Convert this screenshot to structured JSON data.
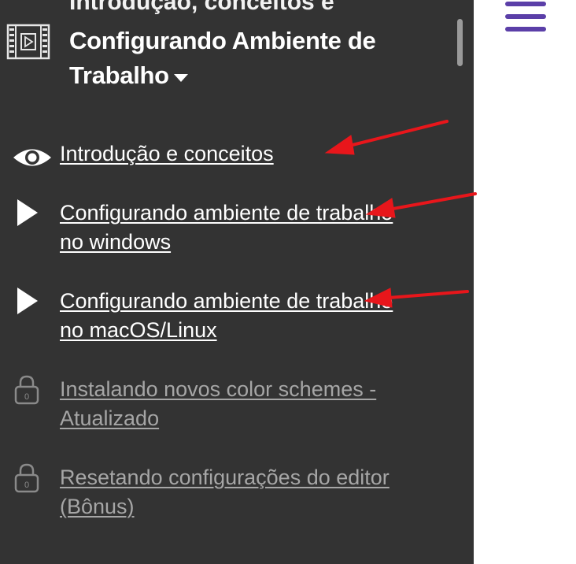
{
  "section": {
    "title": "Configurando Ambiente de Trabalho",
    "cut_heading": "Introdução, conceitos e"
  },
  "lessons": [
    {
      "title": "Introdução e conceitos",
      "icon": "eye-icon",
      "locked": false
    },
    {
      "title": "Configurando ambiente de trabalho no windows",
      "icon": "play-icon",
      "locked": false
    },
    {
      "title": "Configurando ambiente de trabalho no macOS/Linux",
      "icon": "play-icon",
      "locked": false
    },
    {
      "title": "Instalando novos color schemes - Atualizado",
      "icon": "lock-icon",
      "locked": true
    },
    {
      "title": "Resetando configurações do editor (Bônus)",
      "icon": "lock-icon",
      "locked": true
    }
  ],
  "colors": {
    "sidebar_bg": "#333333",
    "active_text": "#ffffff",
    "locked_text": "#a6a6a6",
    "menu_icon": "#5b3fa8",
    "annotation_arrow": "#e8161b"
  }
}
